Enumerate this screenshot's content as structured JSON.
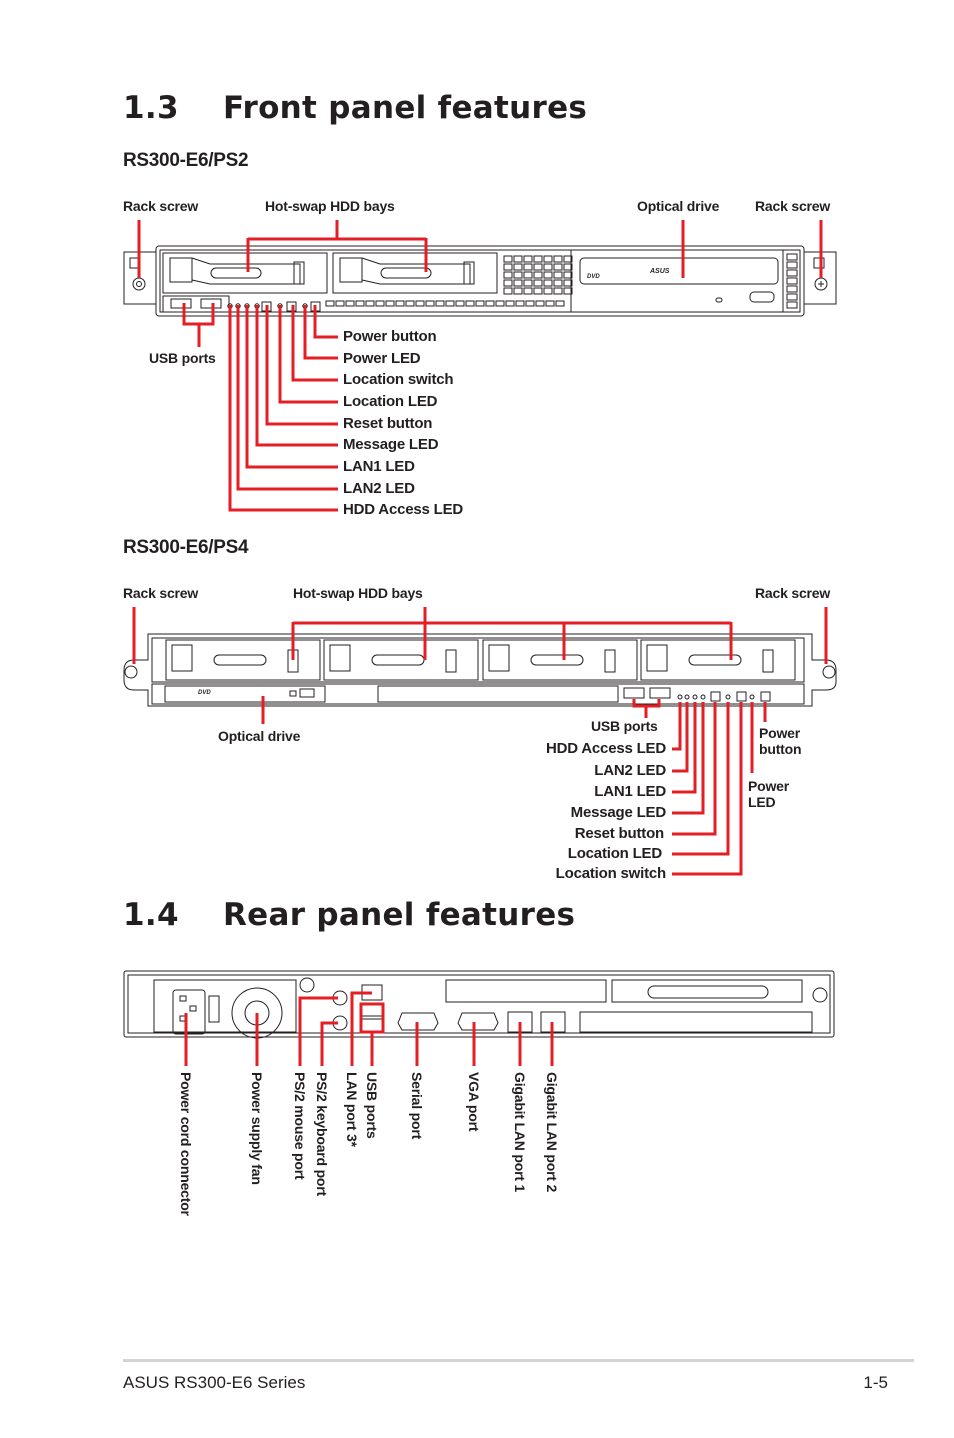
{
  "sections": {
    "front": {
      "number": "1.3",
      "title": "Front panel features"
    },
    "rear": {
      "number": "1.4",
      "title": "Rear panel features"
    }
  },
  "ps2": {
    "model": "RS300-E6/PS2",
    "labels": {
      "rack_screw_left": "Rack screw",
      "hdd_bays": "Hot-swap HDD bays",
      "optical_drive": "Optical drive",
      "rack_screw_right": "Rack screw",
      "usb_ports": "USB ports"
    },
    "callouts": [
      "Power button",
      "Power LED",
      "Location switch",
      "Location LED",
      "Reset button",
      "Message LED",
      "LAN1 LED",
      "LAN2 LED",
      "HDD Access LED"
    ],
    "drive_brand": "ASUS",
    "drive_type": "DVD"
  },
  "ps4": {
    "model": "RS300-E6/PS4",
    "labels": {
      "rack_screw_left": "Rack screw",
      "hdd_bays": "Hot-swap HDD bays",
      "rack_screw_right": "Rack screw",
      "optical_drive": "Optical drive",
      "usb_ports": "USB ports",
      "power_button_1": "Power",
      "power_button_2": "button",
      "power_led_1": "Power",
      "power_led_2": "LED"
    },
    "callouts": [
      "HDD Access LED",
      "LAN2 LED",
      "LAN1 LED",
      "Message LED",
      "Reset button",
      "Location LED",
      "Location switch"
    ],
    "drive_type": "DVD"
  },
  "rear": {
    "callouts": [
      "Power cord connector",
      "Power supply fan",
      "PS/2 mouse port",
      "PS/2 keyboard port",
      "LAN port 3*",
      "USB ports",
      "Serial port",
      "VGA port",
      "Gigabit LAN port 1",
      "Gigabit LAN port 2"
    ]
  },
  "footer": {
    "left": "ASUS RS300-E6 Series",
    "right": "1-5"
  },
  "colors": {
    "callout_line": "#e31e24",
    "text": "#231f20",
    "drawing": "#231f20"
  }
}
